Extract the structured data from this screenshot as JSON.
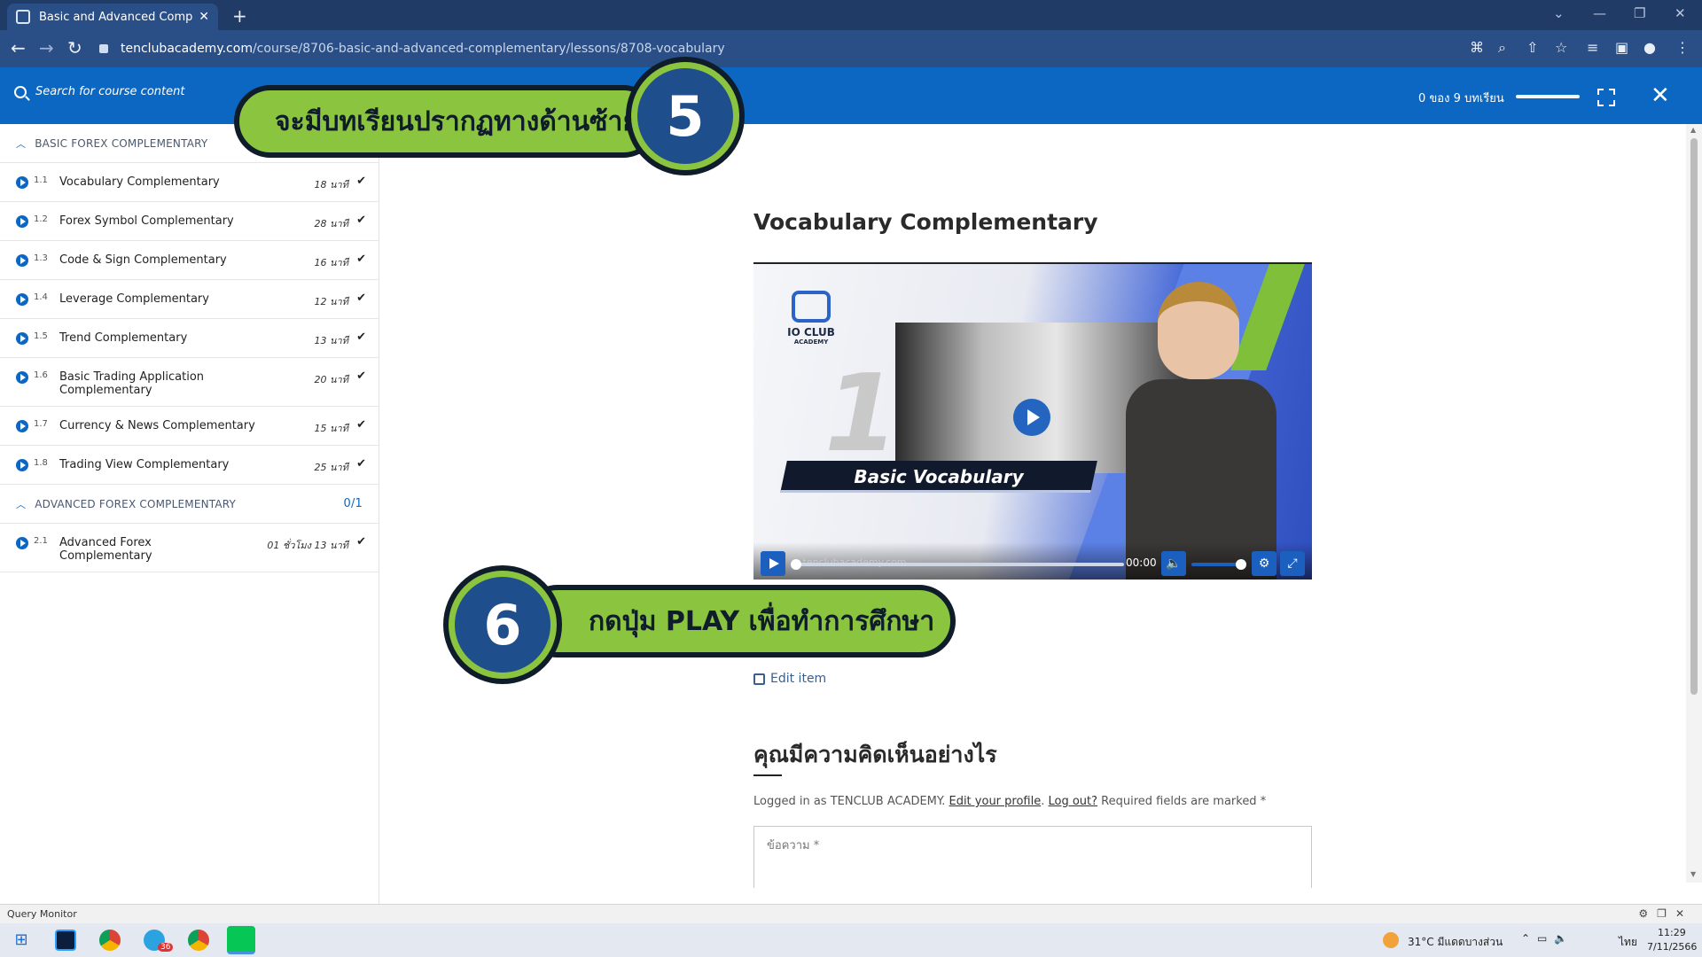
{
  "browser": {
    "tab_title": "Basic and Advanced Compleme",
    "url_domain": "tenclubacademy.com",
    "url_path": "/course/8706-basic-and-advanced-complementary/lessons/8708-vocabulary"
  },
  "header": {
    "search_placeholder": "Search for course content",
    "progress_text": "0 ของ 9 บทเรียน"
  },
  "sidebar": {
    "sections": [
      {
        "title": "BASIC FOREX COMPLEMENTARY",
        "count": "",
        "lessons": [
          {
            "num": "1.1",
            "title": "Vocabulary Complementary",
            "duration": "18 นาที"
          },
          {
            "num": "1.2",
            "title": "Forex Symbol Complementary",
            "duration": "28 นาที"
          },
          {
            "num": "1.3",
            "title": "Code & Sign Complementary",
            "duration": "16 นาที"
          },
          {
            "num": "1.4",
            "title": "Leverage Complementary",
            "duration": "12 นาที"
          },
          {
            "num": "1.5",
            "title": "Trend Complementary",
            "duration": "13 นาที"
          },
          {
            "num": "1.6",
            "title": "Basic Trading Application Complementary",
            "duration": "20 นาที"
          },
          {
            "num": "1.7",
            "title": "Currency & News Complementary",
            "duration": "15 นาที"
          },
          {
            "num": "1.8",
            "title": "Trading View Complementary",
            "duration": "25 นาที"
          }
        ]
      },
      {
        "title": "ADVANCED FOREX COMPLEMENTARY",
        "count": "0/1",
        "lessons": [
          {
            "num": "2.1",
            "title": "Advanced Forex Complementary",
            "duration": "01 ชั่วโมง 13 นาที"
          }
        ]
      }
    ]
  },
  "main": {
    "lesson_title": "Vocabulary Complementary",
    "video": {
      "logo_text": "IO CLUB",
      "logo_sub": "ACADEMY",
      "big_number": "1",
      "caption": "Basic Vocabulary",
      "watermark": "w.tenclubacademy.com",
      "time": "00:00"
    },
    "edit_item": "Edit item",
    "comment_heading": "คุณมีความคิดเห็นอย่างไร",
    "logged_in_prefix": "Logged in as TENCLUB ACADEMY.",
    "edit_profile": "Edit your profile",
    "logout": "Log out?",
    "required_text": "Required fields are marked *",
    "comment_placeholder": "ข้อความ *"
  },
  "callouts": {
    "five": {
      "number": "5",
      "text": "จะมีบทเรียนปรากฏทางด้านซ้าย"
    },
    "six": {
      "number": "6",
      "text_pre": "กดปุ่ม ",
      "text_bold": "PLAY",
      "text_post": " เพื่อทำการศึกษา"
    }
  },
  "status_bar": {
    "label": "Query Monitor"
  },
  "taskbar": {
    "weather": "31°C  มีแดดบางส่วน",
    "lang": "ไทย",
    "time": "11:29",
    "date": "7/11/2566",
    "badge": "36"
  },
  "colors": {
    "brand_blue": "#0b67c2",
    "callout_green": "#8bc43f",
    "callout_navy": "#1f4e8c"
  }
}
